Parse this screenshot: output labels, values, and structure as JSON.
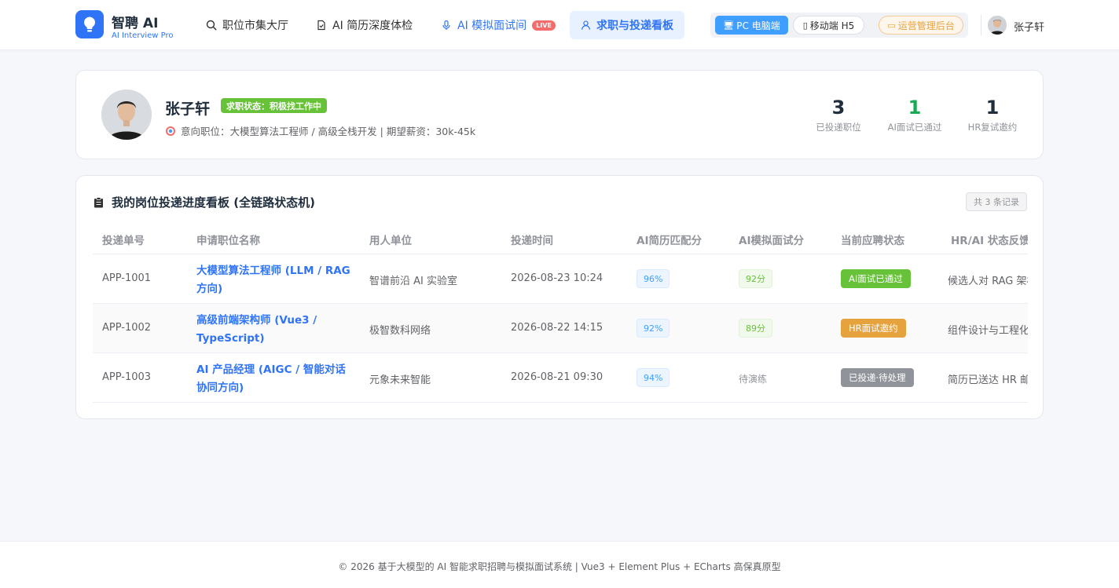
{
  "header": {
    "brand_name": "智聘 AI",
    "brand_sub": "AI Interview Pro",
    "nav": [
      {
        "label": "职位市集大厅",
        "icon": "search-icon"
      },
      {
        "label": "AI 简历深度体检",
        "icon": "document-check-icon"
      },
      {
        "label": "AI 模拟面试间",
        "icon": "microphone-icon",
        "badge": "LIVE"
      },
      {
        "label": "求职与投递看板",
        "icon": "user-icon"
      }
    ],
    "switches": {
      "pc": "PC 电脑端",
      "h5": "移动端 H5",
      "admin": "运营管理后台"
    },
    "user_name": "张子轩"
  },
  "profile": {
    "name": "张子轩",
    "status": "求职状态：积极找工作中",
    "intent": "意向职位：大模型算法工程师 / 高级全栈开发 | 期望薪资：30k-45k",
    "stats": [
      {
        "value": "3",
        "label": "已投递职位",
        "color": "#1f2d3d"
      },
      {
        "value": "1",
        "label": "AI面试已通过",
        "color": "#1aaa55"
      },
      {
        "value": "1",
        "label": "HR复试邀约",
        "color": "#1f2d3d"
      }
    ]
  },
  "board": {
    "title": "我的岗位投递进度看板 (全链路状态机)",
    "count": "共 3 条记录",
    "columns": [
      "投递单号",
      "申请职位名称",
      "用人单位",
      "投递时间",
      "AI简历匹配分",
      "AI模拟面试分",
      "当前应聘状态",
      "HR/AI 状态反馈"
    ],
    "rows": [
      {
        "id": "APP-1001",
        "job": "大模型算法工程师 (LLM / RAG 方向)",
        "company": "智谱前沿 AI 实验室",
        "time": "2026-08-23 10:24",
        "resume_score": "96%",
        "interview_score": "92分",
        "status": "AI面试已通过",
        "status_color": "#67c23a",
        "feedback": "候选人对 RAG 架构理解深入"
      },
      {
        "id": "APP-1002",
        "job": "高级前端架构师 (Vue3 / TypeScript)",
        "company": "极智数科网络",
        "time": "2026-08-22 14:15",
        "resume_score": "92%",
        "interview_score": "89分",
        "status": "HR面试邀约",
        "status_color": "#e6a23c",
        "feedback": "组件设计与工程化能力优秀"
      },
      {
        "id": "APP-1003",
        "job": "AI 产品经理 (AIGC / 智能对话协同方向)",
        "company": "元象未来智能",
        "time": "2026-08-21 09:30",
        "resume_score": "94%",
        "interview_score": "待演练",
        "status": "已投递·待处理",
        "status_color": "#909399",
        "feedback": "简历已送达 HR 邮箱"
      }
    ]
  },
  "footer": {
    "text": "© 2026 基于大模型的 AI 智能求职招聘与模拟面试系统 | Vue3 + Element Plus + ECharts 高保真原型"
  }
}
